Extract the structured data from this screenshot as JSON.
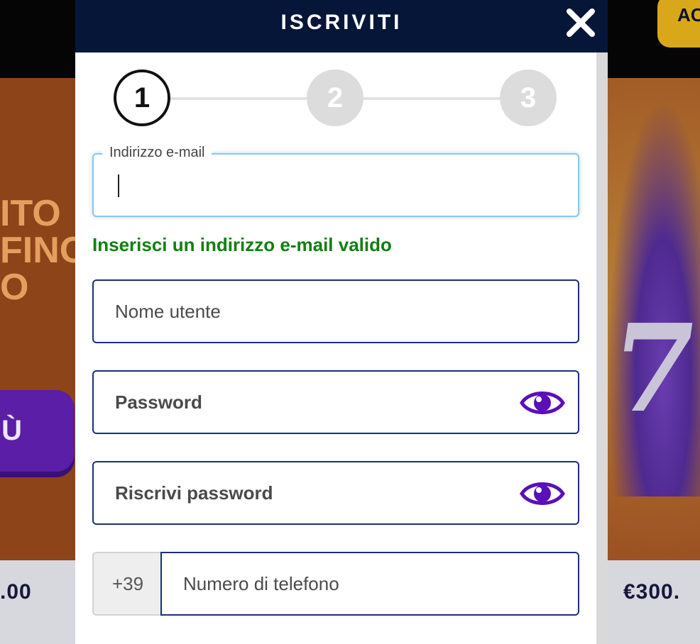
{
  "background": {
    "login_button_label": "AC",
    "banner_left_lines": [
      "ITO",
      "FINO",
      "O"
    ],
    "banner_button_label": "Ù",
    "banner_art_glyph": "7",
    "amount_left": ".00",
    "amount_right": "€300."
  },
  "modal": {
    "title": "ISCRIVITI",
    "close_icon": "close-icon",
    "steps": [
      {
        "label": "1",
        "state": "active"
      },
      {
        "label": "2",
        "state": "inactive"
      },
      {
        "label": "3",
        "state": "inactive"
      }
    ]
  },
  "form": {
    "email": {
      "label": "Indirizzo e-mail",
      "value": ""
    },
    "email_validation": "Inserisci un indirizzo e-mail valido",
    "username": {
      "placeholder": "Nome utente"
    },
    "password": {
      "placeholder": "Password",
      "toggle_icon": "eye-icon"
    },
    "confirm_password": {
      "placeholder": "Riscrivi password",
      "toggle_icon": "eye-icon"
    },
    "phone": {
      "prefix": "+39",
      "placeholder": "Numero di telefono"
    }
  },
  "colors": {
    "header_bg": "#061638",
    "field_border": "#1c2f7a",
    "focus_border": "#8cc6ee",
    "validation_green": "#118011",
    "eye_purple": "#5a0fb8"
  }
}
